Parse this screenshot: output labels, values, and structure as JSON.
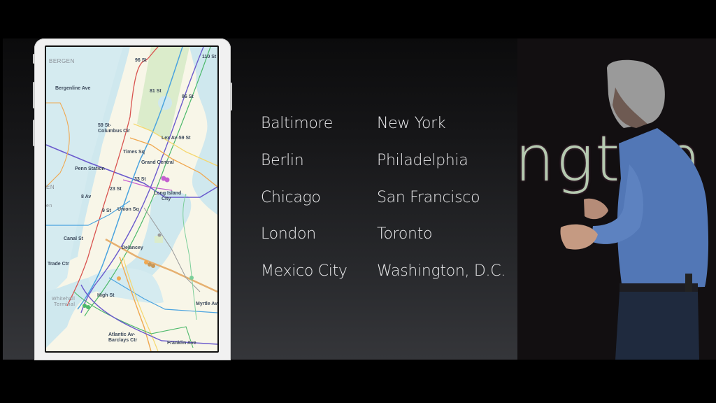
{
  "slide": {
    "cities_left": [
      "Baltimore",
      "Berlin",
      "Chicago",
      "London",
      "Mexico City"
    ],
    "cities_right": [
      "New York",
      "Philadelphia",
      "San Francisco",
      "Toronto",
      "Washington, D.C."
    ],
    "text_color": "#e8e8ea"
  },
  "stage": {
    "backdrop_text": "ngton"
  },
  "map": {
    "area_labels": [
      "BERGEN",
      "EN",
      "en"
    ],
    "station_labels": [
      "96 St",
      "110 St",
      "81 St",
      "86 St",
      "Bergenline Ave",
      "59 St-",
      "Columbus Cir",
      "Lex Av-59 St",
      "Times Sq",
      "Grand Central",
      "Penn Station",
      "33 St",
      "23 St",
      "Long Island",
      "City",
      "8 Av",
      "9 St",
      "Union Sq",
      "Canal St",
      "Delancey",
      "Trade Ctr",
      "High St",
      "Whitehall",
      "Terminal",
      "Myrtle Av",
      "Atlantic Av-",
      "Barclays Ctr",
      "Franklin Ave"
    ],
    "line_colors": {
      "red": "#d9534f",
      "orange": "#f0a850",
      "yellow": "#f5d76e",
      "green": "#4cb96a",
      "blue": "#4aa3df",
      "purple": "#6a5acd",
      "magenta": "#c45fd0",
      "gray": "#999999",
      "water": "#cfe8ee",
      "park": "#dbeccb"
    }
  }
}
